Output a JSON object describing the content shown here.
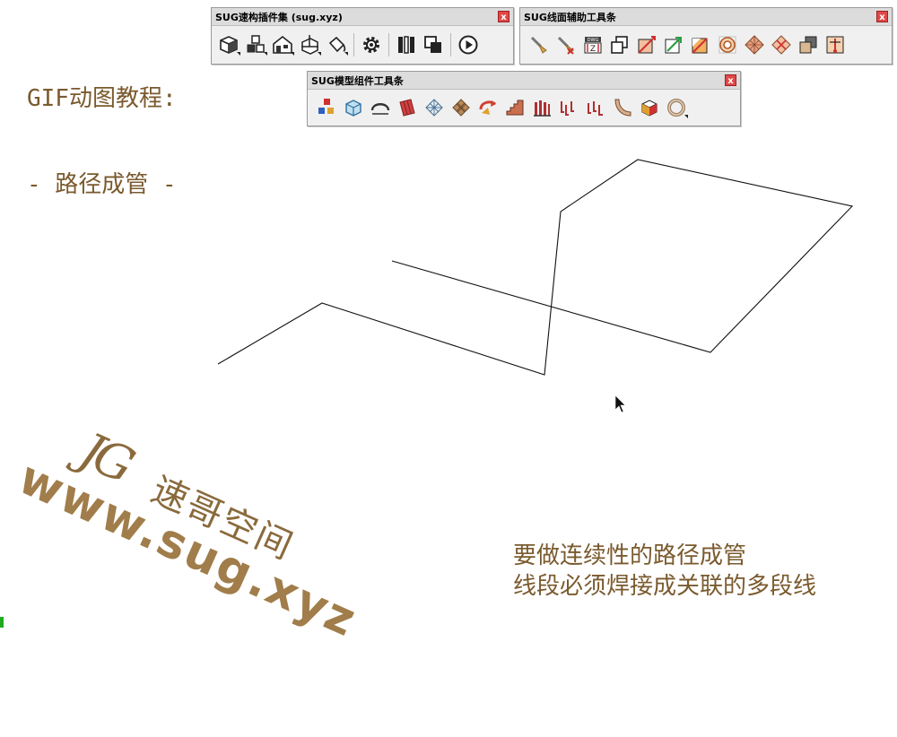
{
  "tutorial": {
    "title_line1": "GIF动图教程:",
    "title_line2": "- 路径成管 -"
  },
  "toolbars": {
    "speed": {
      "title": "SUG速构插件集 (sug.xyz)",
      "close": "x",
      "tools": [
        "box-icon",
        "cubes-icon",
        "house-icon",
        "axis-box-icon",
        "paint-bucket-icon",
        "gear-icon",
        "columns-icon",
        "copy-icon",
        "play-icon"
      ]
    },
    "line_face": {
      "title": "SUG线面辅助工具条",
      "close": "x",
      "tools": [
        "brush-icon",
        "brush-delete-icon",
        "dwg-z-icon",
        "offset-squares-icon",
        "diagonal-line-icon",
        "arrow-diagonal-icon",
        "face-diagonal-icon",
        "circle-spiral-icon",
        "diamond-grid-icon",
        "diamond-cross-icon",
        "stack-box-icon",
        "marker-icon"
      ]
    },
    "model": {
      "title": "SUG模型组件工具条",
      "close": "x",
      "tools": [
        "component-cubes-icon",
        "glass-box-icon",
        "arch-icon",
        "red-panel-icon",
        "network-icon",
        "diamond-mesh-icon",
        "arrows-flip-icon",
        "stairs-icon",
        "red-bars-icon",
        "spikes-icon",
        "spikes-2-icon",
        "curve-icon",
        "rubik-cube-icon",
        "ring-icon"
      ]
    }
  },
  "watermark": {
    "logo": "JG",
    "name_cn": "速哥空间",
    "url": "www.sug.xyz"
  },
  "caption": {
    "line1": "要做连续性的路径成管",
    "line2": "线段必须焊接成关联的多段线"
  },
  "colors": {
    "accent_text": "#7a5a2e",
    "watermark": "#8a6a3c",
    "close_button": "#e04848"
  }
}
